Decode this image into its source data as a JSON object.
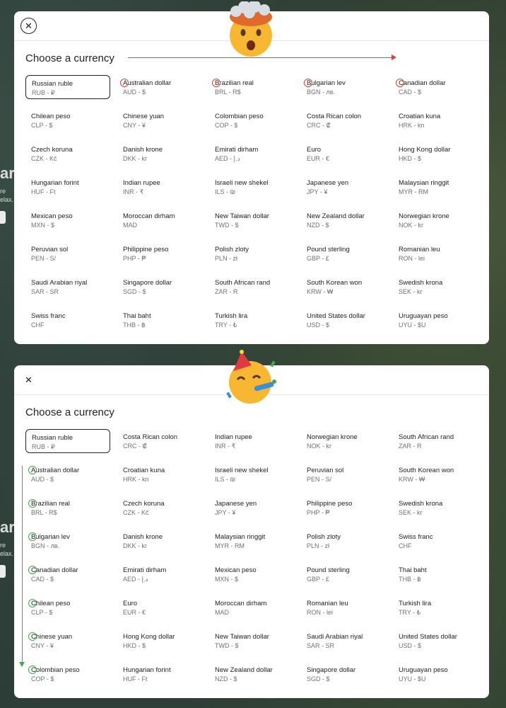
{
  "top": {
    "title": "Choose a currency",
    "close_icon": "close-icon",
    "emoji": "exploding-head-emoji",
    "currencies": [
      {
        "name": "Russian ruble",
        "code": "RUB - ₽"
      },
      {
        "name": "Australian dollar",
        "code": "AUD - $"
      },
      {
        "name": "Brazilian real",
        "code": "BRL - R$"
      },
      {
        "name": "Bulgarian lev",
        "code": "BGN - лв."
      },
      {
        "name": "Canadian dollar",
        "code": "CAD - $"
      },
      {
        "name": "Chilean peso",
        "code": "CLP - $"
      },
      {
        "name": "Chinese yuan",
        "code": "CNY - ¥"
      },
      {
        "name": "Colombian peso",
        "code": "COP - $"
      },
      {
        "name": "Costa Rican colon",
        "code": "CRC - ₡"
      },
      {
        "name": "Croatian kuna",
        "code": "HRK - kn"
      },
      {
        "name": "Czech koruna",
        "code": "CZK - Kč"
      },
      {
        "name": "Danish krone",
        "code": "DKK - kr"
      },
      {
        "name": "Emirati dirham",
        "code": "AED - د.إ"
      },
      {
        "name": "Euro",
        "code": "EUR - €"
      },
      {
        "name": "Hong Kong dollar",
        "code": "HKD - $"
      },
      {
        "name": "Hungarian forint",
        "code": "HUF - Ft"
      },
      {
        "name": "Indian rupee",
        "code": "INR - ₹"
      },
      {
        "name": "Israeli new shekel",
        "code": "ILS - ₪"
      },
      {
        "name": "Japanese yen",
        "code": "JPY - ¥"
      },
      {
        "name": "Malaysian ringgit",
        "code": "MYR - RM"
      },
      {
        "name": "Mexican peso",
        "code": "MXN - $"
      },
      {
        "name": "Moroccan dirham",
        "code": "MAD"
      },
      {
        "name": "New Taiwan dollar",
        "code": "TWD - $"
      },
      {
        "name": "New Zealand dollar",
        "code": "NZD - $"
      },
      {
        "name": "Norwegian krone",
        "code": "NOK - kr"
      },
      {
        "name": "Peruvian sol",
        "code": "PEN - S/"
      },
      {
        "name": "Philippine peso",
        "code": "PHP - ₱"
      },
      {
        "name": "Polish zloty",
        "code": "PLN - zł"
      },
      {
        "name": "Pound sterling",
        "code": "GBP - £"
      },
      {
        "name": "Romanian leu",
        "code": "RON - lei"
      },
      {
        "name": "Saudi Arabian riyal",
        "code": "SAR - SR"
      },
      {
        "name": "Singapore dollar",
        "code": "SGD - $"
      },
      {
        "name": "South African rand",
        "code": "ZAR - R"
      },
      {
        "name": "South Korean won",
        "code": "KRW - ₩"
      },
      {
        "name": "Swedish krona",
        "code": "SEK - kr"
      },
      {
        "name": "Swiss franc",
        "code": "CHF"
      },
      {
        "name": "Thai baht",
        "code": "THB - ฿"
      },
      {
        "name": "Turkish lira",
        "code": "TRY - ₺"
      },
      {
        "name": "United States dollar",
        "code": "USD - $"
      },
      {
        "name": "Uruguayan peso",
        "code": "UYU - $U"
      }
    ]
  },
  "bottom": {
    "title": "Choose a currency",
    "close_icon": "close-icon",
    "emoji": "partying-face-emoji",
    "currencies": [
      {
        "name": "Russian ruble",
        "code": "RUB - ₽"
      },
      {
        "name": "Costa Rican colon",
        "code": "CRC - ₡"
      },
      {
        "name": "Indian rupee",
        "code": "INR - ₹"
      },
      {
        "name": "Norwegian krone",
        "code": "NOK - kr"
      },
      {
        "name": "South African rand",
        "code": "ZAR - R"
      },
      {
        "name": "Australian dollar",
        "code": "AUD - $"
      },
      {
        "name": "Croatian kuna",
        "code": "HRK - kn"
      },
      {
        "name": "Israeli new shekel",
        "code": "ILS - ₪"
      },
      {
        "name": "Peruvian sol",
        "code": "PEN - S/"
      },
      {
        "name": "South Korean won",
        "code": "KRW - ₩"
      },
      {
        "name": "Brazilian real",
        "code": "BRL - R$"
      },
      {
        "name": "Czech koruna",
        "code": "CZK - Kč"
      },
      {
        "name": "Japanese yen",
        "code": "JPY - ¥"
      },
      {
        "name": "Philippine peso",
        "code": "PHP - ₱"
      },
      {
        "name": "Swedish krona",
        "code": "SEK - kr"
      },
      {
        "name": "Bulgarian lev",
        "code": "BGN - лв."
      },
      {
        "name": "Danish krone",
        "code": "DKK - kr"
      },
      {
        "name": "Malaysian ringgit",
        "code": "MYR - RM"
      },
      {
        "name": "Polish zloty",
        "code": "PLN - zł"
      },
      {
        "name": "Swiss franc",
        "code": "CHF"
      },
      {
        "name": "Canadian dollar",
        "code": "CAD - $"
      },
      {
        "name": "Emirati dirham",
        "code": "AED - د.إ"
      },
      {
        "name": "Mexican peso",
        "code": "MXN - $"
      },
      {
        "name": "Pound sterling",
        "code": "GBP - £"
      },
      {
        "name": "Thai baht",
        "code": "THB - ฿"
      },
      {
        "name": "Chilean peso",
        "code": "CLP - $"
      },
      {
        "name": "Euro",
        "code": "EUR - €"
      },
      {
        "name": "Moroccan dirham",
        "code": "MAD"
      },
      {
        "name": "Romanian leu",
        "code": "RON - lei"
      },
      {
        "name": "Turkish lira",
        "code": "TRY - ₺"
      },
      {
        "name": "Chinese yuan",
        "code": "CNY - ¥"
      },
      {
        "name": "Hong Kong dollar",
        "code": "HKD - $"
      },
      {
        "name": "New Taiwan dollar",
        "code": "TWD - $"
      },
      {
        "name": "Saudi Arabian riyal",
        "code": "SAR - SR"
      },
      {
        "name": "United States dollar",
        "code": "USD - $"
      },
      {
        "name": "Colombian peso",
        "code": "COP - $"
      },
      {
        "name": "Hungarian forint",
        "code": "HUF - Ft"
      },
      {
        "name": "New Zealand dollar",
        "code": "NZD - $"
      },
      {
        "name": "Singapore dollar",
        "code": "SGD - $"
      },
      {
        "name": "Uruguayan peso",
        "code": "UYU - $U"
      }
    ]
  },
  "background": {
    "heading_fragment_1": "ar",
    "subtext_fragment_1a": "re",
    "subtext_fragment_1b": "elax.",
    "heading_fragment_2": "ar",
    "subtext_fragment_2a": "re",
    "subtext_fragment_2b": "elax."
  },
  "colors": {
    "annotation_red": "#d9433b",
    "annotation_green": "#3dab4a",
    "selected_border": "#222222"
  }
}
